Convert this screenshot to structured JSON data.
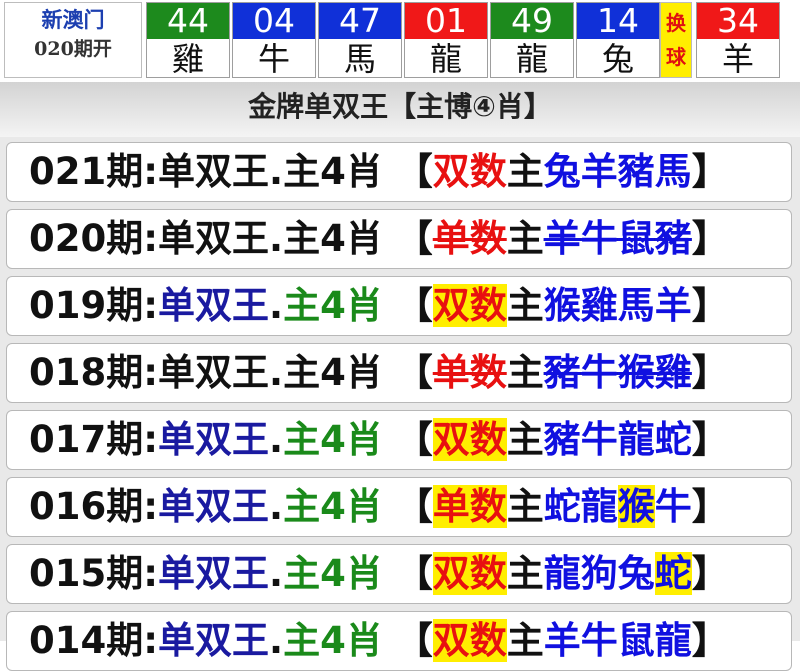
{
  "header": {
    "site": "新澳门",
    "issue": "020期开",
    "swap_label": [
      "换",
      "球"
    ],
    "balls": [
      {
        "number": "44",
        "zodiac": "雞",
        "color": "#1d8a1d"
      },
      {
        "number": "04",
        "zodiac": "牛",
        "color": "#1030d8"
      },
      {
        "number": "47",
        "zodiac": "馬",
        "color": "#1030d8"
      },
      {
        "number": "01",
        "zodiac": "龍",
        "color": "#f01818"
      },
      {
        "number": "49",
        "zodiac": "龍",
        "color": "#1d8a1d"
      },
      {
        "number": "14",
        "zodiac": "兔",
        "color": "#1030d8"
      },
      {
        "number": "34",
        "zodiac": "羊",
        "color": "#f01818"
      }
    ]
  },
  "title": "金牌单双王【主博④肖】",
  "rows": [
    {
      "period": "021期",
      "game": "单双王",
      "main": "主4肖",
      "parity": "双数",
      "zhu": "主",
      "zodiacs": [
        "兔",
        "羊",
        "豬",
        "馬"
      ],
      "result": "pending"
    },
    {
      "period": "020期",
      "game": "单双王",
      "main": "主4肖",
      "parity": "单数",
      "zhu": "主",
      "zodiacs": [
        "羊",
        "牛",
        "鼠",
        "豬"
      ],
      "result": "miss"
    },
    {
      "period": "019期",
      "game": "单双王",
      "main": "主4肖",
      "parity": "双数",
      "zhu": "主",
      "zodiacs": [
        "猴",
        "雞",
        "馬",
        "羊"
      ],
      "result": "hit"
    },
    {
      "period": "018期",
      "game": "单双王",
      "main": "主4肖",
      "parity": "单数",
      "zhu": "主",
      "zodiacs": [
        "豬",
        "牛",
        "猴",
        "雞"
      ],
      "result": "miss"
    },
    {
      "period": "017期",
      "game": "单双王",
      "main": "主4肖",
      "parity": "双数",
      "zhu": "主",
      "zodiacs": [
        "豬",
        "牛",
        "龍",
        "蛇"
      ],
      "result": "hit"
    },
    {
      "period": "016期",
      "game": "单双王",
      "main": "主4肖",
      "parity": "单数",
      "zhu": "主",
      "zodiacs": [
        "蛇",
        "龍",
        "猴",
        "牛"
      ],
      "result": "hit",
      "hit_zodiac": 2
    },
    {
      "period": "015期",
      "game": "单双王",
      "main": "主4肖",
      "parity": "双数",
      "zhu": "主",
      "zodiacs": [
        "龍",
        "狗",
        "兔",
        "蛇"
      ],
      "result": "hit",
      "hit_zodiac": 3
    },
    {
      "period": "014期",
      "game": "单双王",
      "main": "主4肖",
      "parity": "双数",
      "zhu": "主",
      "zodiacs": [
        "羊",
        "牛",
        "鼠",
        "龍"
      ],
      "result": "hit"
    }
  ]
}
